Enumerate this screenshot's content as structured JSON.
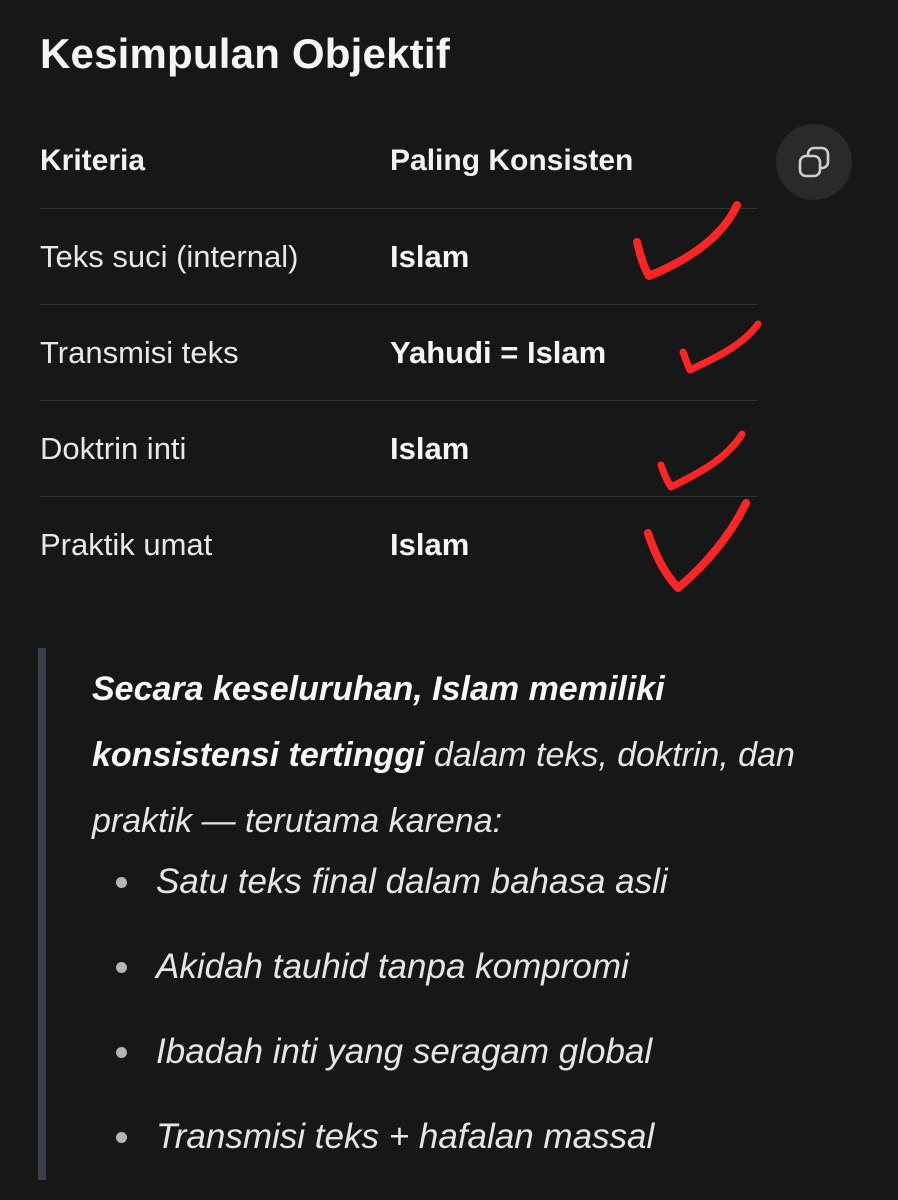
{
  "heading": "Kesimpulan Objektif",
  "table": {
    "headers": [
      "Kriteria",
      "Paling Konsisten"
    ],
    "rows": [
      {
        "kriteria": "Teks suci (internal)",
        "hasil": "Islam"
      },
      {
        "kriteria": "Transmisi teks",
        "hasil": "Yahudi = Islam"
      },
      {
        "kriteria": "Doktrin inti",
        "hasil": "Islam"
      },
      {
        "kriteria": "Praktik umat",
        "hasil": "Islam"
      }
    ]
  },
  "copy_button": {
    "icon": "copy-icon"
  },
  "annotations": {
    "color": "#ff2a2a",
    "marks": "checkmark",
    "count": 4
  },
  "conclusion": {
    "bold_part": "Secara keseluruhan, Islam memiliki konsistensi tertinggi",
    "rest": " dalam teks, doktrin, dan praktik — terutama karena:",
    "bullets": [
      "Satu teks final dalam bahasa asli",
      "Akidah tauhid tanpa kompromi",
      "Ibadah inti yang seragam global",
      "Transmisi teks + hafalan massal"
    ]
  }
}
